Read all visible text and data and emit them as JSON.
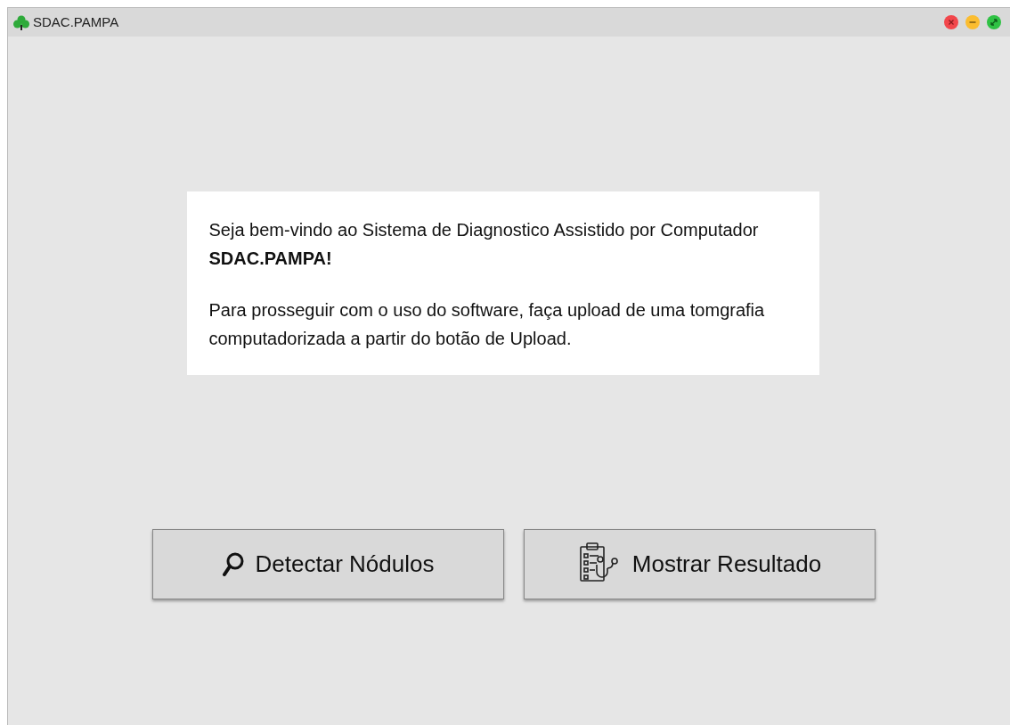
{
  "window": {
    "title": "SDAC.PAMPA"
  },
  "welcome": {
    "paragraphs": [
      "Seja bem-vindo ao Sistema de Diagnostico Assistido por Computador **SDAC.PAMPA!**",
      "Para prosseguir com o uso do software, faça upload de uma tomgrafia computadorizada a partir do botão de Upload."
    ]
  },
  "buttons": [
    {
      "kind": "search",
      "label": "Detectar Nódulos"
    },
    {
      "kind": "report",
      "label": "Mostrar Resultado"
    }
  ]
}
